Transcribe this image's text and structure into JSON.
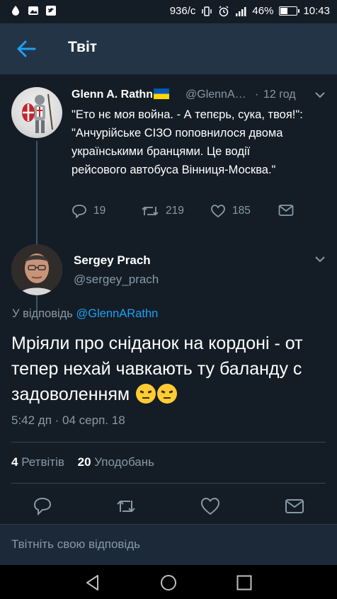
{
  "status_bar": {
    "speed": "936/с",
    "battery_percent": "46%",
    "battery_level": 0.46,
    "time": "10:43",
    "icons": [
      "droplet-icon",
      "image-icon",
      "twitter-icon",
      "vibrate-icon",
      "alarm-icon",
      "signal-icon",
      "battery-icon"
    ]
  },
  "header": {
    "title": "Твіт"
  },
  "parent_tweet": {
    "name": "Glenn A. Rathn",
    "flag": "ukraine-flag-icon",
    "handle": "@GlennA…",
    "separator": "·",
    "time": "12 год",
    "text": "\"Ето нє моя война. - А тепєрь, сука, твоя!\": \"Анчурійське СІЗО поповнилося двома українськими бранцями. Це водії рейсового автобуса Вінниця-Москва.\"",
    "replies": "19",
    "retweets": "219",
    "likes": "185"
  },
  "main_tweet": {
    "name": "Sergey Prach",
    "handle": "@sergey_prach",
    "reply_prefix": "У відповідь ",
    "reply_to": "@GlennARathn",
    "text": "Мріяли про сніданок на кордоні - от тепер нехай чавкають ту баланду с задоволенням",
    "emojis": [
      "angry-face-icon",
      "angry-face-icon"
    ],
    "timestamp": "5:42 дп · 04 серп. 18",
    "retweets_count": "4",
    "retweets_label": "Ретвітів",
    "likes_count": "20",
    "likes_label": "Уподобань"
  },
  "reply_box": {
    "placeholder": "Твітніть свою відповідь"
  },
  "colors": {
    "background": "#141d26",
    "header": "#243447",
    "accent": "#1da1f2",
    "muted": "#8899a6",
    "flag_blue": "#0057b7",
    "flag_yellow": "#ffd700"
  }
}
